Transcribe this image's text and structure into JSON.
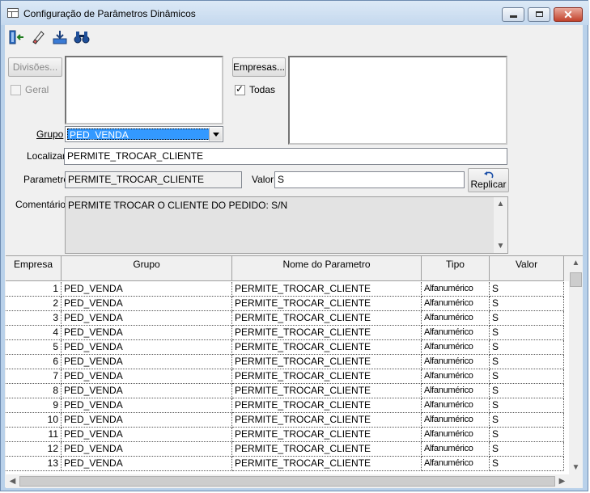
{
  "window": {
    "title": "Configuração de Parâmetros Dinâmicos",
    "close_glyph": "✕"
  },
  "toolbar": {
    "icons": [
      "exit-door-icon",
      "eraser-icon",
      "save-tray-icon",
      "binoculars-icon"
    ]
  },
  "filters": {
    "divisoes_button": "Divisões...",
    "geral_label": "Geral",
    "geral_checked": false,
    "empresas_button": "Empresas...",
    "todas_label": "Todas",
    "todas_checked": true,
    "todas_mark": "✓",
    "grupo_label": "Grupo",
    "grupo_value": "PED_VENDA",
    "localizar_label": "Localizar",
    "localizar_value": "PERMITE_TROCAR_CLIENTE",
    "parametro_label": "Parametro",
    "parametro_value": "PERMITE_TROCAR_CLIENTE",
    "valor_label": "Valor",
    "valor_value": "S",
    "replicar_button": "Replicar",
    "comentarios_label": "Comentários",
    "comentarios_value": "PERMITE TROCAR O CLIENTE DO PEDIDO: S/N"
  },
  "grid": {
    "columns": [
      "Empresa",
      "Grupo",
      "Nome do Parametro",
      "Tipo",
      "Valor"
    ],
    "rows": [
      {
        "empresa": "1",
        "grupo": "PED_VENDA",
        "nome": "PERMITE_TROCAR_CLIENTE",
        "tipo": "Alfanumérico",
        "valor": "S"
      },
      {
        "empresa": "2",
        "grupo": "PED_VENDA",
        "nome": "PERMITE_TROCAR_CLIENTE",
        "tipo": "Alfanumérico",
        "valor": "S"
      },
      {
        "empresa": "3",
        "grupo": "PED_VENDA",
        "nome": "PERMITE_TROCAR_CLIENTE",
        "tipo": "Alfanumérico",
        "valor": "S"
      },
      {
        "empresa": "4",
        "grupo": "PED_VENDA",
        "nome": "PERMITE_TROCAR_CLIENTE",
        "tipo": "Alfanumérico",
        "valor": "S"
      },
      {
        "empresa": "5",
        "grupo": "PED_VENDA",
        "nome": "PERMITE_TROCAR_CLIENTE",
        "tipo": "Alfanumérico",
        "valor": "S"
      },
      {
        "empresa": "6",
        "grupo": "PED_VENDA",
        "nome": "PERMITE_TROCAR_CLIENTE",
        "tipo": "Alfanumérico",
        "valor": "S"
      },
      {
        "empresa": "7",
        "grupo": "PED_VENDA",
        "nome": "PERMITE_TROCAR_CLIENTE",
        "tipo": "Alfanumérico",
        "valor": "S"
      },
      {
        "empresa": "8",
        "grupo": "PED_VENDA",
        "nome": "PERMITE_TROCAR_CLIENTE",
        "tipo": "Alfanumérico",
        "valor": "S"
      },
      {
        "empresa": "9",
        "grupo": "PED_VENDA",
        "nome": "PERMITE_TROCAR_CLIENTE",
        "tipo": "Alfanumérico",
        "valor": "S"
      },
      {
        "empresa": "10",
        "grupo": "PED_VENDA",
        "nome": "PERMITE_TROCAR_CLIENTE",
        "tipo": "Alfanumérico",
        "valor": "S"
      },
      {
        "empresa": "11",
        "grupo": "PED_VENDA",
        "nome": "PERMITE_TROCAR_CLIENTE",
        "tipo": "Alfanumérico",
        "valor": "S"
      },
      {
        "empresa": "12",
        "grupo": "PED_VENDA",
        "nome": "PERMITE_TROCAR_CLIENTE",
        "tipo": "Alfanumérico",
        "valor": "S"
      },
      {
        "empresa": "13",
        "grupo": "PED_VENDA",
        "nome": "PERMITE_TROCAR_CLIENTE",
        "tipo": "Alfanumérico",
        "valor": "S"
      }
    ]
  },
  "scroll_glyphs": {
    "up": "▲",
    "down": "▼",
    "left": "◀",
    "right": "▶"
  },
  "colors": {
    "selection": "#3399ff",
    "title_bar": "#c4d8ee",
    "close_button": "#c2422c"
  }
}
